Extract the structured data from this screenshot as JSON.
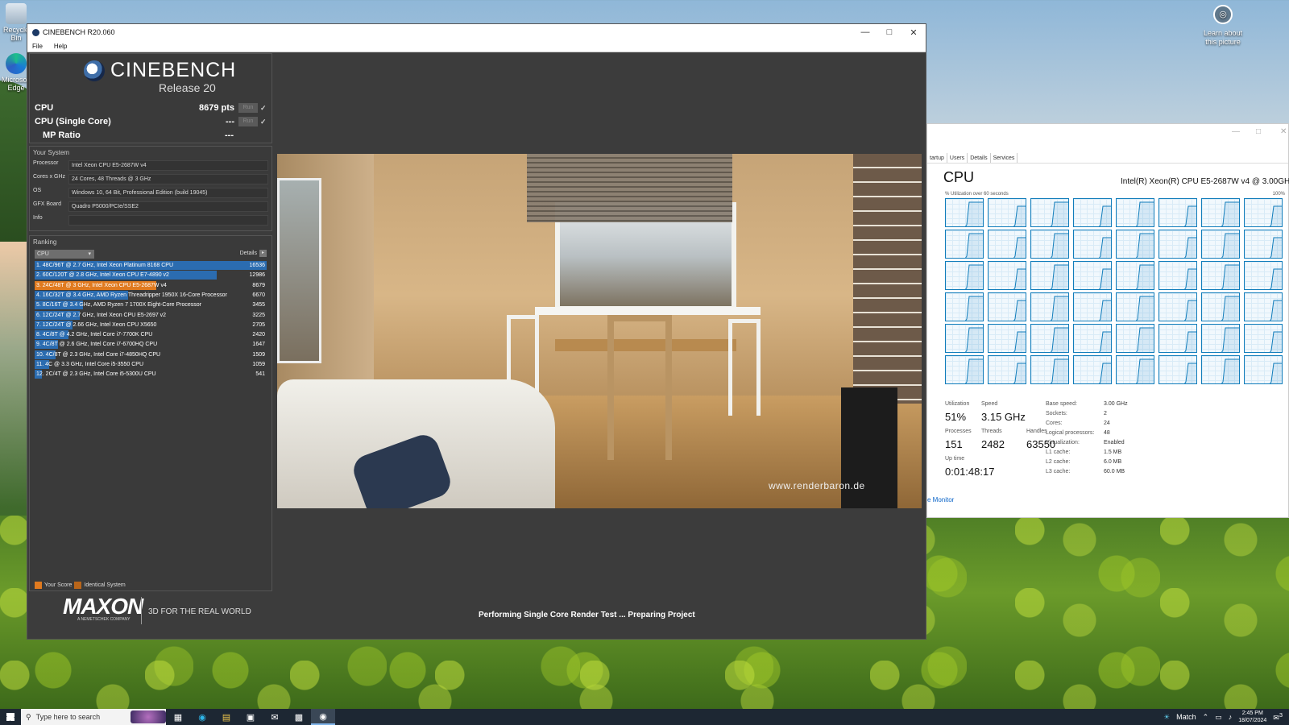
{
  "desktop": {
    "icons": [
      {
        "label": "Recycle Bin"
      },
      {
        "label": "Microsoft Edge"
      }
    ],
    "learn_label": "Learn about this picture"
  },
  "cinebench": {
    "window_title": "CINEBENCH R20.060",
    "menu": [
      "File",
      "Help"
    ],
    "brand_name": "CINEBENCH",
    "brand_release": "Release 20",
    "scores": [
      {
        "label": "CPU",
        "value": "8679 pts",
        "run": "Run",
        "check": "✓"
      },
      {
        "label": "CPU (Single Core)",
        "value": "---",
        "run": "Run",
        "check": "✓"
      },
      {
        "label": "MP Ratio",
        "value": "---"
      }
    ],
    "system_title": "Your System",
    "system": [
      {
        "k": "Processor",
        "v": "Intel Xeon CPU E5-2687W v4"
      },
      {
        "k": "Cores x GHz",
        "v": "24 Cores, 48 Threads @ 3 GHz"
      },
      {
        "k": "OS",
        "v": "Windows 10, 64 Bit, Professional Edition (build 19045)"
      },
      {
        "k": "GFX Board",
        "v": "Quadro P5000/PCIe/SSE2"
      },
      {
        "k": "Info",
        "v": ""
      }
    ],
    "ranking_title": "Ranking",
    "ranking_dropdown": "CPU",
    "ranking_details": "Details",
    "ranking": [
      {
        "label": "1. 48C/96T @ 2.7 GHz, Intel Xeon Platinum 8168 CPU",
        "score": "16536",
        "value": 16536,
        "kind": "blue"
      },
      {
        "label": "2. 60C/120T @ 2.8 GHz, Intel Xeon CPU E7-4890 v2",
        "score": "12986",
        "value": 12986,
        "kind": "blue"
      },
      {
        "label": "3. 24C/48T @ 3 GHz, Intel Xeon CPU E5-2687W v4",
        "score": "8679",
        "value": 8679,
        "kind": "orange"
      },
      {
        "label": "4. 16C/32T @ 3.4 GHz, AMD Ryzen Threadripper 1950X 16-Core Processor",
        "score": "6670",
        "value": 6670,
        "kind": "blue"
      },
      {
        "label": "5. 8C/16T @ 3.4 GHz, AMD Ryzen 7 1700X Eight-Core Processor",
        "score": "3455",
        "value": 3455,
        "kind": "blue"
      },
      {
        "label": "6. 12C/24T @ 2.7 GHz, Intel Xeon CPU E5-2697 v2",
        "score": "3225",
        "value": 3225,
        "kind": "blue"
      },
      {
        "label": "7. 12C/24T @ 2.66 GHz, Intel Xeon CPU X5650",
        "score": "2705",
        "value": 2705,
        "kind": "blue"
      },
      {
        "label": "8. 4C/8T @ 4.2 GHz, Intel Core i7-7700K CPU",
        "score": "2420",
        "value": 2420,
        "kind": "blue"
      },
      {
        "label": "9. 4C/8T @ 2.6 GHz, Intel Core i7-6700HQ CPU",
        "score": "1647",
        "value": 1647,
        "kind": "blue"
      },
      {
        "label": "10. 4C/8T @ 2.3 GHz, Intel Core i7-4850HQ CPU",
        "score": "1509",
        "value": 1509,
        "kind": "blue"
      },
      {
        "label": "11. 4C @ 3.3 GHz, Intel Core i5-3550 CPU",
        "score": "1059",
        "value": 1059,
        "kind": "blue"
      },
      {
        "label": "12. 2C/4T @ 2.3 GHz, Intel Core i5-5300U CPU",
        "score": "541",
        "value": 541,
        "kind": "blue"
      }
    ],
    "legend_your_score": "Your Score",
    "legend_identical": "Identical System",
    "maxon": "MAXON",
    "maxon_sub": "A NEMETSCHEK COMPANY",
    "maxon_tagline": "3D FOR THE REAL WORLD",
    "status": "Performing Single Core Render Test ... Preparing Project",
    "watermark": "www.renderbaron.de",
    "colors": {
      "bar_blue": "#2b6cb0",
      "bar_orange": "#e07a1f"
    }
  },
  "taskmgr": {
    "tabs": [
      "tartup",
      "Users",
      "Details",
      "Services"
    ],
    "heading": "CPU",
    "model": "Intel(R) Xeon(R) CPU E5-2687W v4 @ 3.00GHz",
    "util_label": "% Utilization over 60 seconds",
    "pct_label": "100%",
    "stats": {
      "utilization_label": "Utilization",
      "utilization": "51%",
      "speed_label": "Speed",
      "speed": "3.15 GHz",
      "processes_label": "Processes",
      "processes": "151",
      "threads_label": "Threads",
      "threads": "2482",
      "handles_label": "Handles",
      "handles": "63550",
      "uptime_label": "Up time",
      "uptime": "0:01:48:17"
    },
    "details": [
      {
        "k": "Base speed:",
        "v": "3.00 GHz"
      },
      {
        "k": "Sockets:",
        "v": "2"
      },
      {
        "k": "Cores:",
        "v": "24"
      },
      {
        "k": "Logical processors:",
        "v": "48"
      },
      {
        "k": "Virtualization:",
        "v": "Enabled"
      },
      {
        "k": "L1 cache:",
        "v": "1.5 MB"
      },
      {
        "k": "L2 cache:",
        "v": "6.0 MB"
      },
      {
        "k": "L3 cache:",
        "v": "60.0 MB"
      }
    ],
    "monitor_link": "e Monitor",
    "colors": {
      "graph": "#117dbb"
    }
  },
  "taskbar": {
    "search_placeholder": "Type here to search",
    "weather": "Match",
    "time": "2:45 PM",
    "date": "18/07/2024",
    "notifications": "3"
  }
}
